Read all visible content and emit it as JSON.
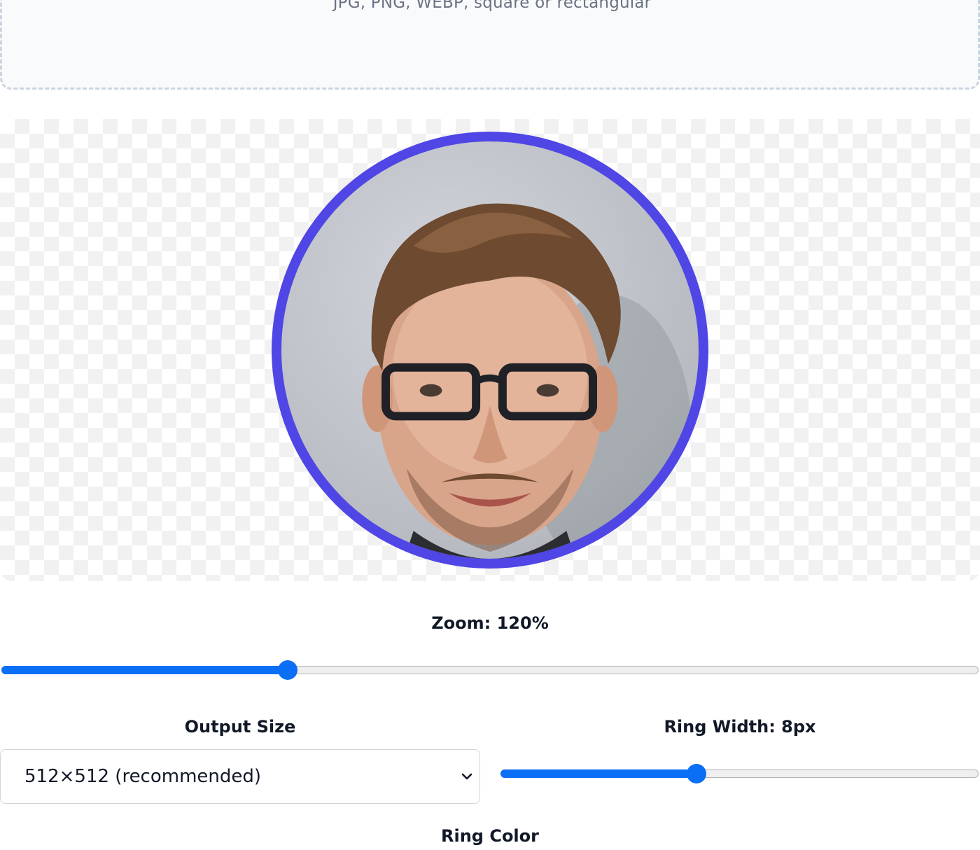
{
  "dropzone": {
    "hint": "JPG, PNG, WEBP, square or rectangular"
  },
  "preview": {
    "ring_color": "#4f46e5"
  },
  "zoom": {
    "label": "Zoom: 120%",
    "fraction": 0.293
  },
  "output_size": {
    "label": "Output Size",
    "selected": "512×512 (recommended)"
  },
  "ring_width": {
    "label": "Ring Width: 8px",
    "fraction": 0.41
  },
  "ring_color": {
    "label": "Ring Color"
  },
  "accent_color": "#0b6ff5"
}
